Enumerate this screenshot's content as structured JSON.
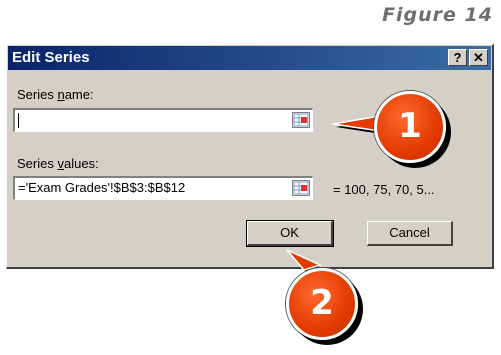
{
  "figure": {
    "label": "Figure 14"
  },
  "dialog": {
    "title": "Edit Series",
    "help_glyph": "?",
    "close_glyph": "✕",
    "series_name": {
      "label_pre": "Series ",
      "label_access": "n",
      "label_post": "ame:",
      "value": ""
    },
    "series_values": {
      "label_pre": "Series ",
      "label_access": "v",
      "label_post": "alues:",
      "value": "='Exam Grades'!$B$3:$B$12",
      "preview": "= 100, 75, 70, 5..."
    },
    "ok_label": "OK",
    "cancel_label": "Cancel"
  },
  "callouts": [
    {
      "number": "1",
      "target": "series-name-input"
    },
    {
      "number": "2",
      "target": "ok-button"
    }
  ],
  "colors": {
    "titlebar_start": "#0a246a",
    "titlebar_end": "#3a6ea5",
    "dialog_face": "#d4d0c8",
    "callout_fill": "#e33a00"
  }
}
